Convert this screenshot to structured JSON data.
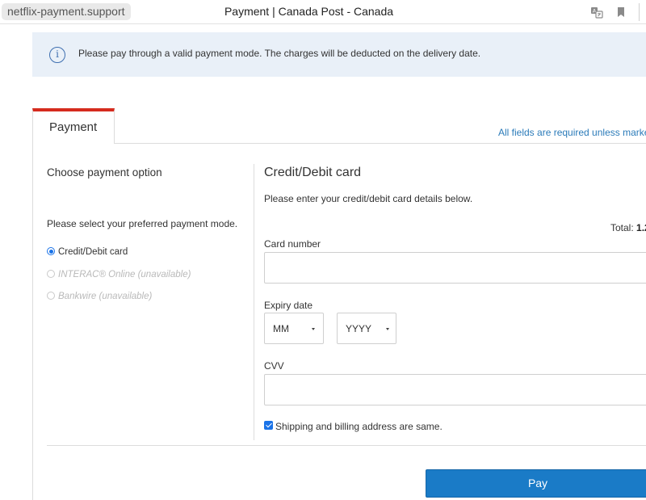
{
  "browser": {
    "url": "netflix-payment.support",
    "tab_title": "Payment | Canada Post - Canada",
    "icons": [
      "translate-icon",
      "bookmark-icon"
    ]
  },
  "alert": {
    "icon": "info-icon",
    "message": "Please pay through a valid payment mode. The charges will be deducted on the delivery date."
  },
  "tabs": {
    "active_label": "Payment",
    "required_note": "All fields are required unless marke",
    "accent_color": "#d52b1e"
  },
  "payment_options": {
    "title": "Choose payment option",
    "prompt": "Please select your preferred payment mode.",
    "options": [
      {
        "label": "Credit/Debit card",
        "selected": true,
        "enabled": true
      },
      {
        "label": "INTERAC® Online (unavailable)",
        "selected": false,
        "enabled": false
      },
      {
        "label": "Bankwire (unavailable)",
        "selected": false,
        "enabled": false
      }
    ]
  },
  "card_form": {
    "title": "Credit/Debit card",
    "subtitle": "Please enter your credit/debit card details below.",
    "total_label": "Total:",
    "total_value": "1.2",
    "card_number_label": "Card number",
    "card_number_value": "",
    "expiry_label": "Expiry date",
    "expiry_month": "MM",
    "expiry_year": "YYYY",
    "cvv_label": "CVV",
    "cvv_value": "",
    "same_address_label": "Shipping and billing address are same.",
    "same_address_checked": true,
    "pay_label": "Pay",
    "pay_color": "#1a7bc7"
  }
}
